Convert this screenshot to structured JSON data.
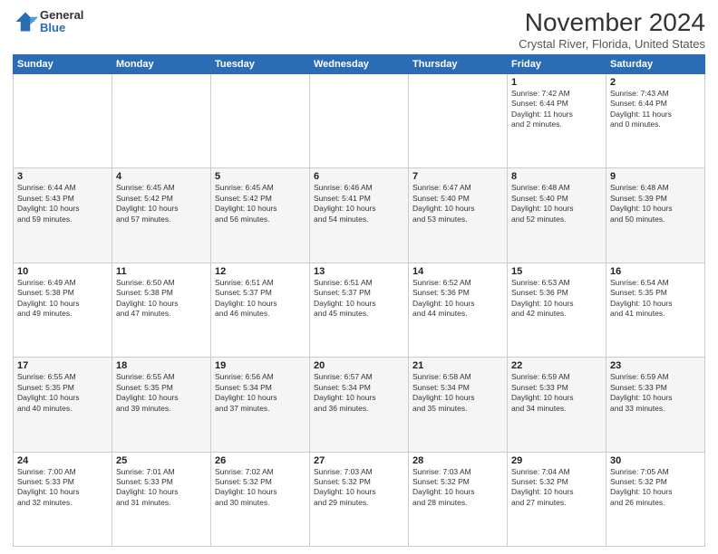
{
  "header": {
    "logo_general": "General",
    "logo_blue": "Blue",
    "title": "November 2024",
    "subtitle": "Crystal River, Florida, United States"
  },
  "weekdays": [
    "Sunday",
    "Monday",
    "Tuesday",
    "Wednesday",
    "Thursday",
    "Friday",
    "Saturday"
  ],
  "weeks": [
    [
      {
        "day": "",
        "info": ""
      },
      {
        "day": "",
        "info": ""
      },
      {
        "day": "",
        "info": ""
      },
      {
        "day": "",
        "info": ""
      },
      {
        "day": "",
        "info": ""
      },
      {
        "day": "1",
        "info": "Sunrise: 7:42 AM\nSunset: 6:44 PM\nDaylight: 11 hours\nand 2 minutes."
      },
      {
        "day": "2",
        "info": "Sunrise: 7:43 AM\nSunset: 6:44 PM\nDaylight: 11 hours\nand 0 minutes."
      }
    ],
    [
      {
        "day": "3",
        "info": "Sunrise: 6:44 AM\nSunset: 5:43 PM\nDaylight: 10 hours\nand 59 minutes."
      },
      {
        "day": "4",
        "info": "Sunrise: 6:45 AM\nSunset: 5:42 PM\nDaylight: 10 hours\nand 57 minutes."
      },
      {
        "day": "5",
        "info": "Sunrise: 6:45 AM\nSunset: 5:42 PM\nDaylight: 10 hours\nand 56 minutes."
      },
      {
        "day": "6",
        "info": "Sunrise: 6:46 AM\nSunset: 5:41 PM\nDaylight: 10 hours\nand 54 minutes."
      },
      {
        "day": "7",
        "info": "Sunrise: 6:47 AM\nSunset: 5:40 PM\nDaylight: 10 hours\nand 53 minutes."
      },
      {
        "day": "8",
        "info": "Sunrise: 6:48 AM\nSunset: 5:40 PM\nDaylight: 10 hours\nand 52 minutes."
      },
      {
        "day": "9",
        "info": "Sunrise: 6:48 AM\nSunset: 5:39 PM\nDaylight: 10 hours\nand 50 minutes."
      }
    ],
    [
      {
        "day": "10",
        "info": "Sunrise: 6:49 AM\nSunset: 5:38 PM\nDaylight: 10 hours\nand 49 minutes."
      },
      {
        "day": "11",
        "info": "Sunrise: 6:50 AM\nSunset: 5:38 PM\nDaylight: 10 hours\nand 47 minutes."
      },
      {
        "day": "12",
        "info": "Sunrise: 6:51 AM\nSunset: 5:37 PM\nDaylight: 10 hours\nand 46 minutes."
      },
      {
        "day": "13",
        "info": "Sunrise: 6:51 AM\nSunset: 5:37 PM\nDaylight: 10 hours\nand 45 minutes."
      },
      {
        "day": "14",
        "info": "Sunrise: 6:52 AM\nSunset: 5:36 PM\nDaylight: 10 hours\nand 44 minutes."
      },
      {
        "day": "15",
        "info": "Sunrise: 6:53 AM\nSunset: 5:36 PM\nDaylight: 10 hours\nand 42 minutes."
      },
      {
        "day": "16",
        "info": "Sunrise: 6:54 AM\nSunset: 5:35 PM\nDaylight: 10 hours\nand 41 minutes."
      }
    ],
    [
      {
        "day": "17",
        "info": "Sunrise: 6:55 AM\nSunset: 5:35 PM\nDaylight: 10 hours\nand 40 minutes."
      },
      {
        "day": "18",
        "info": "Sunrise: 6:55 AM\nSunset: 5:35 PM\nDaylight: 10 hours\nand 39 minutes."
      },
      {
        "day": "19",
        "info": "Sunrise: 6:56 AM\nSunset: 5:34 PM\nDaylight: 10 hours\nand 37 minutes."
      },
      {
        "day": "20",
        "info": "Sunrise: 6:57 AM\nSunset: 5:34 PM\nDaylight: 10 hours\nand 36 minutes."
      },
      {
        "day": "21",
        "info": "Sunrise: 6:58 AM\nSunset: 5:34 PM\nDaylight: 10 hours\nand 35 minutes."
      },
      {
        "day": "22",
        "info": "Sunrise: 6:59 AM\nSunset: 5:33 PM\nDaylight: 10 hours\nand 34 minutes."
      },
      {
        "day": "23",
        "info": "Sunrise: 6:59 AM\nSunset: 5:33 PM\nDaylight: 10 hours\nand 33 minutes."
      }
    ],
    [
      {
        "day": "24",
        "info": "Sunrise: 7:00 AM\nSunset: 5:33 PM\nDaylight: 10 hours\nand 32 minutes."
      },
      {
        "day": "25",
        "info": "Sunrise: 7:01 AM\nSunset: 5:33 PM\nDaylight: 10 hours\nand 31 minutes."
      },
      {
        "day": "26",
        "info": "Sunrise: 7:02 AM\nSunset: 5:32 PM\nDaylight: 10 hours\nand 30 minutes."
      },
      {
        "day": "27",
        "info": "Sunrise: 7:03 AM\nSunset: 5:32 PM\nDaylight: 10 hours\nand 29 minutes."
      },
      {
        "day": "28",
        "info": "Sunrise: 7:03 AM\nSunset: 5:32 PM\nDaylight: 10 hours\nand 28 minutes."
      },
      {
        "day": "29",
        "info": "Sunrise: 7:04 AM\nSunset: 5:32 PM\nDaylight: 10 hours\nand 27 minutes."
      },
      {
        "day": "30",
        "info": "Sunrise: 7:05 AM\nSunset: 5:32 PM\nDaylight: 10 hours\nand 26 minutes."
      }
    ]
  ]
}
